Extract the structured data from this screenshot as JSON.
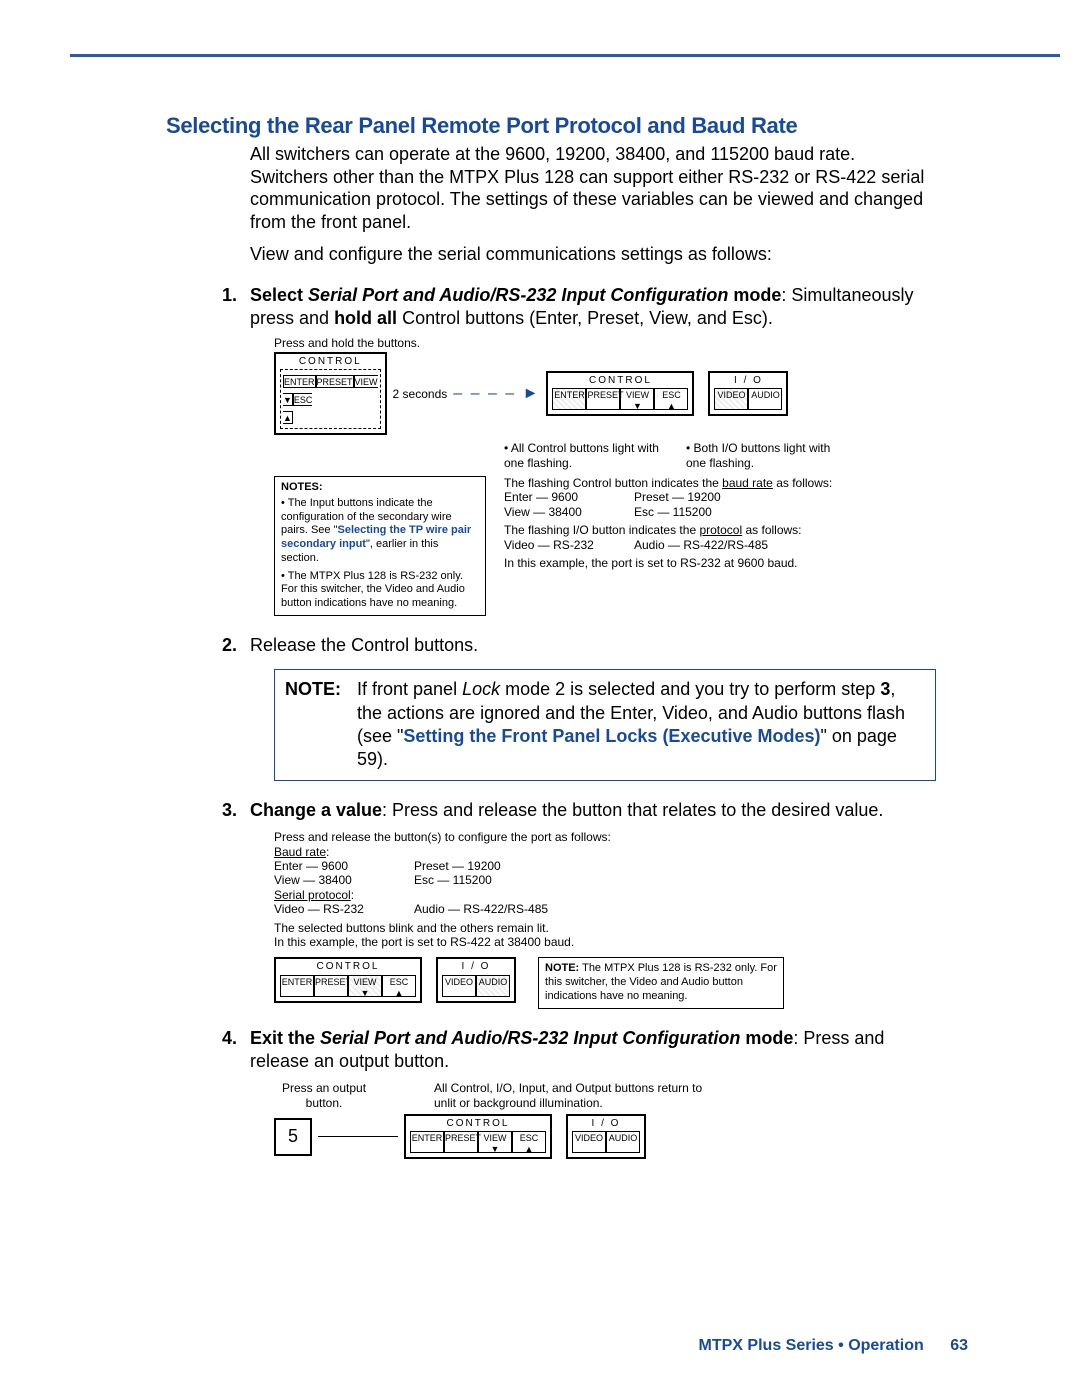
{
  "heading": "Selecting the Rear Panel Remote Port Protocol and Baud Rate",
  "intro1": "All switchers can operate at the 9600, 19200, 38400, and 115200 baud rate. Switchers other than the MTPX Plus 128 can support either RS-232 or RS-422 serial communication protocol. The settings of these variables can be viewed and changed from the front panel.",
  "intro2": "View and configure the serial communications settings as follows:",
  "step1": {
    "num": "1.",
    "lead": "Select ",
    "mode": "Serial Port and Audio/RS-232 Input Configuration",
    "mode_suffix": " mode",
    "rest": ": Simultaneously press and ",
    "hold": "hold all",
    "rest2": " Control buttons (Enter, Preset, View, and Esc)."
  },
  "diagram1": {
    "press_hold": "Press and hold the buttons.",
    "panel_control": "CONTROL",
    "panel_io": "I / O",
    "btns_control": [
      "ENTER",
      "PRESET",
      "VIEW\n▼",
      "ESC\n▲"
    ],
    "btns_io": [
      "VIDEO",
      "AUDIO"
    ],
    "two_seconds": "2 seconds",
    "cap_control": "All Control buttons light with one flashing.",
    "cap_io": "Both I/O buttons light with one flashing.",
    "notes_label": "NOTES:",
    "notes_b1a": "The Input buttons indicate the configuration of the secondary wire pairs. See \"",
    "notes_b1_link": "Selecting the TP wire pair secondary input",
    "notes_b1b": "\", earlier in this section.",
    "notes_b2": "The MTPX Plus 128 is RS-232 only. For this switcher, the Video and Audio button indications have no meaning.",
    "flash_ctrl": "The flashing Control button indicates the ",
    "baud_rate_u": "baud rate",
    "flash_ctrl2": " as follows:",
    "baud_pairs": [
      "Enter — 9600",
      "Preset — 19200",
      "View — 38400",
      "Esc — 115200"
    ],
    "flash_io": "The flashing I/O button indicates the ",
    "protocol_u": "protocol",
    "flash_io2": " as follows:",
    "proto_pairs": [
      "Video — RS-232",
      "Audio — RS-422/RS-485"
    ],
    "example": "In this example, the port is set to RS-232 at 9600 baud."
  },
  "step2": {
    "num": "2.",
    "text": "Release the Control buttons."
  },
  "notebox": {
    "label": "NOTE:",
    "t1": "If front panel ",
    "lock": "Lock",
    "t2": " mode 2 is selected and you try to perform step ",
    "three": "3",
    "t3": ", the actions are ignored and the Enter, Video, and Audio buttons flash (see \"",
    "link": "Setting the Front Panel Locks (Executive Modes)",
    "t4": "\" on page 59)."
  },
  "step3": {
    "num": "3.",
    "lead": "Change a value",
    "rest": ": Press and release the button that relates to the desired value."
  },
  "diagram3": {
    "intro": "Press and release the button(s) to configure the port as follows:",
    "baud_u": "Baud rate",
    "baud_pairs": [
      "Enter — 9600",
      "Preset — 19200",
      "View — 38400",
      "Esc — 115200"
    ],
    "proto_u": "Serial protocol",
    "proto_pairs": [
      "Video — RS-232",
      "Audio — RS-422/RS-485"
    ],
    "blink": "The selected buttons blink and the others remain lit.",
    "example": "In this example, the port is set to RS-422 at 38400 baud.",
    "note_label": "NOTE:",
    "note_text": "The MTPX Plus 128 is RS-232 only. For this switcher, the Video and Audio button indications have no meaning."
  },
  "step4": {
    "num": "4.",
    "lead": "Exit the ",
    "mode": "Serial Port and Audio/RS-232 Input Configuration",
    "mode_suffix": " mode",
    "rest": ": Press and release an output button."
  },
  "diagram4": {
    "press": "Press an output button.",
    "five": "5",
    "return": "All Control, I/O, Input, and Output buttons return to unlit or background illumination."
  },
  "footer": {
    "text": "MTPX Plus Series • Operation",
    "page": "63"
  }
}
